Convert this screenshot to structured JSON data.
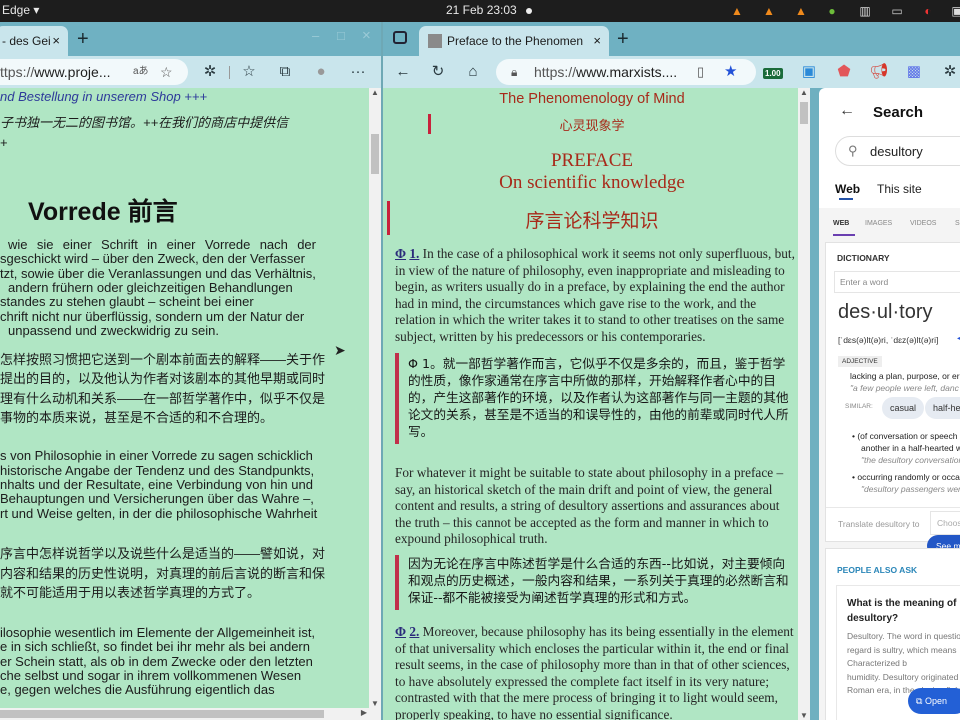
{
  "topbar": {
    "app_menu": "Edge ▾",
    "clock": "21 Feb  23:03",
    "tray_icons": [
      "vlc-icon",
      "vlc-icon",
      "vlc-icon",
      "update-icon",
      "reader-icon",
      "keyboard-icon",
      "network-icon",
      "window-icon"
    ]
  },
  "left_window": {
    "tab_title": "- des Gei",
    "tab_close": "×",
    "new_tab": "+",
    "window_controls": [
      "–",
      "□",
      "×"
    ],
    "url": "https://www.proje...",
    "url_domain": "www.proje...",
    "url_scheme": "ttps://",
    "read_aloud": "aあ",
    "more": "···",
    "page": {
      "shop_line": "nd Bestellung in unserem Shop +++",
      "shop_line_zh": "子书独一无二的图书馆。++在我们的商店中提供信",
      "shop_line_zh2": "+",
      "heading": "Vorrede 前言",
      "p1": [
        "wie sie einer Schrift in einer Vorrede nach der",
        "sgeschickt wird – über den Zweck, den der Verfasser",
        "tzt, sowie über die Veranlassungen und das Verhältnis,",
        "andern frühern oder gleichzeitigen Behandlungen",
        "standes zu stehen glaubt – scheint bei einer",
        "chrift nicht nur überflüssig, sondern um der Natur der",
        "unpassend und zweckwidrig zu sein."
      ],
      "p1_zh": [
        "怎样按照习惯把它送到一个剧本前面去的解释——关于作",
        "提出的目的，以及他认为作者对该剧本的其他早期或同时",
        "理有什么动机和关系——在一部哲学著作中，似乎不仅是",
        "事物的本质来说，甚至是不合适的和不合理的。"
      ],
      "p2": [
        "s von Philosophie in einer Vorrede zu sagen schicklich",
        "historische Angabe der Tendenz und des Standpunkts,",
        "nhalts und der Resultate, eine Verbindung von hin und",
        "Behauptungen und Versicherungen über das Wahre –,",
        "rt und Weise gelten, in der die philosophische Wahrheit"
      ],
      "p2_zh": [
        "序言中怎样说哲学以及说些什么是适当的——譬如说，对",
        "内容和结果的历史性说明，对真理的前后言说的断言和保",
        "就不可能适用于用以表述哲学真理的方式了。"
      ],
      "p3": [
        "ilosophie wesentlich im Elemente der Allgemeinheit ist,",
        "e in sich schließt, so findet bei ihr mehr als bei andern",
        "er Schein statt, als ob in dem Zwecke oder den letzten",
        "che selbst und sogar in ihrem vollkommenen Wesen",
        "e, gegen welches die Ausführung eigentlich das"
      ]
    }
  },
  "right_window": {
    "tab_title": "Preface to the Phenomen",
    "tab_close": "×",
    "new_tab": "+",
    "url_scheme": "https://",
    "url_domain": "www.marxists....",
    "extension_badge": "1.00",
    "page": {
      "title_en": "The Phenomenology of Mind",
      "title_zh": "心灵现象学",
      "preface": "PREFACE",
      "subtitle": "On scientific knowledge",
      "subtitle_zh": "序言论科学知识",
      "para1_marker": "Φ",
      "para1_num": "1.",
      "para1": "In the case of a philosophical work it seems not only superfluous, but, in view of the nature of philosophy, even inappropriate and misleading to begin, as writers usually do in a preface, by explaining the end the author had in mind, the circumstances which gave rise to the work, and the relation in which the writer takes it to stand to other treatises on the same subject, written by his predecessors or his contemporaries.",
      "para1_zh": "Φ 1。就一部哲学著作而言，它似乎不仅是多余的，而且，鉴于哲学的性质，像作家通常在序言中所做的那样，开始解释作者心中的目的，产生这部著作的环境，以及作者认为这部著作与同一主题的其他论文的关系，甚至是不适当的和误导性的，由他的前辈或同时代人所写。",
      "para1b": "For whatever it might be suitable to state about philosophy in a preface – say, an historical sketch of the main drift and point of view, the general content and results, a string of desultory assertions and assurances about the truth – this cannot be accepted as the form and manner in which to expound philosophical truth.",
      "para1b_zh": "因为无论在序言中陈述哲学是什么合适的东西--比如说，对主要倾向和观点的历史概述，一般内容和结果，一系列关于真理的必然断言和保证--都不能被接受为阐述哲学真理的形式和方式。",
      "para2_marker": "Φ",
      "para2_num": "2.",
      "para2": "Moreover, because philosophy has its being essentially in the element of that universality which encloses the particular within it, the end or final result seems, in the case of philosophy more than in that of other sciences, to have absolutely expressed the complete fact itself in its very nature; contrasted with that the mere process of bringing it to light would seem, properly speaking, to have no essential significance."
    },
    "panel": {
      "back": "←",
      "title": "Search",
      "search_value": "desultory",
      "scope_tabs": [
        "Web",
        "This site"
      ],
      "result_tabs": [
        "WEB",
        "IMAGES",
        "VIDEOS",
        "S"
      ],
      "dictionary_label": "DICTIONARY",
      "word_placeholder": "Enter a word",
      "headword": "des·ul·tory",
      "pronunciation": "[ˈdɛs(ə)lt(ə)ri, ˈdɛz(ə)lt(ə)ri]",
      "pos": "ADJECTIVE",
      "def1": "lacking a plan, purpose, or er",
      "def1_example": "\"a few people were left, danc",
      "similar_label": "SIMILAR:",
      "similar": [
        "casual",
        "half-heart"
      ],
      "def2": "(of conversation or speech",
      "def2b": "another in a half-hearted w",
      "def2_example": "\"the desultory conversation",
      "def3": "occurring randomly or occa",
      "def3_example": "\"desultory passengers wer",
      "translate_label": "Translate desultory to",
      "translate_choose": "Choos",
      "see_more": "See mo",
      "paa_label": "PEOPLE ALSO ASK",
      "paa_q": "What is the meaning of desultory?",
      "paa_a": [
        "Desultory. The word in questio",
        "regard is sultry, which means",
        "Characterized b",
        "humidity. Desultory originated",
        "Roman era, in the playing field"
      ],
      "open_button": "Open"
    }
  }
}
